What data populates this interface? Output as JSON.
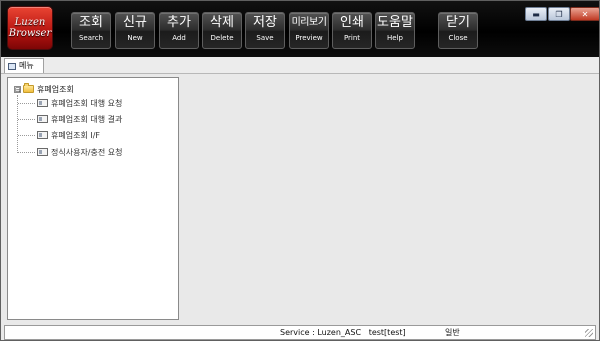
{
  "logo": {
    "line1": "Luzen",
    "line2": "Browser"
  },
  "toolbar": {
    "buttons": [
      {
        "ko": "조회",
        "en": "Search"
      },
      {
        "ko": "신규",
        "en": "New"
      },
      {
        "ko": "추가",
        "en": "Add"
      },
      {
        "ko": "삭제",
        "en": "Delete"
      },
      {
        "ko": "저장",
        "en": "Save"
      },
      {
        "ko": "미리보기",
        "en": "Preview"
      },
      {
        "ko": "인쇄",
        "en": "Print"
      },
      {
        "ko": "도움말",
        "en": "Help"
      },
      {
        "ko": "닫기",
        "en": "Close"
      }
    ]
  },
  "window_controls": {
    "minimize_icon": "minimize-icon",
    "maximize_icon": "maximize-icon",
    "close_icon": "close-icon"
  },
  "tab": {
    "label": "메뉴"
  },
  "tree": {
    "root": {
      "label": "휴폐업조회",
      "expander": "⊟"
    },
    "children": [
      {
        "label": "휴폐업조회 대행 요청"
      },
      {
        "label": "휴폐업조회 대행 결과"
      },
      {
        "label": "휴폐업조회 I/F"
      },
      {
        "label": "정식사용자/충전 요청"
      }
    ]
  },
  "status": {
    "service": "Service : Luzen_ASC   test[test]",
    "level": "일반"
  }
}
